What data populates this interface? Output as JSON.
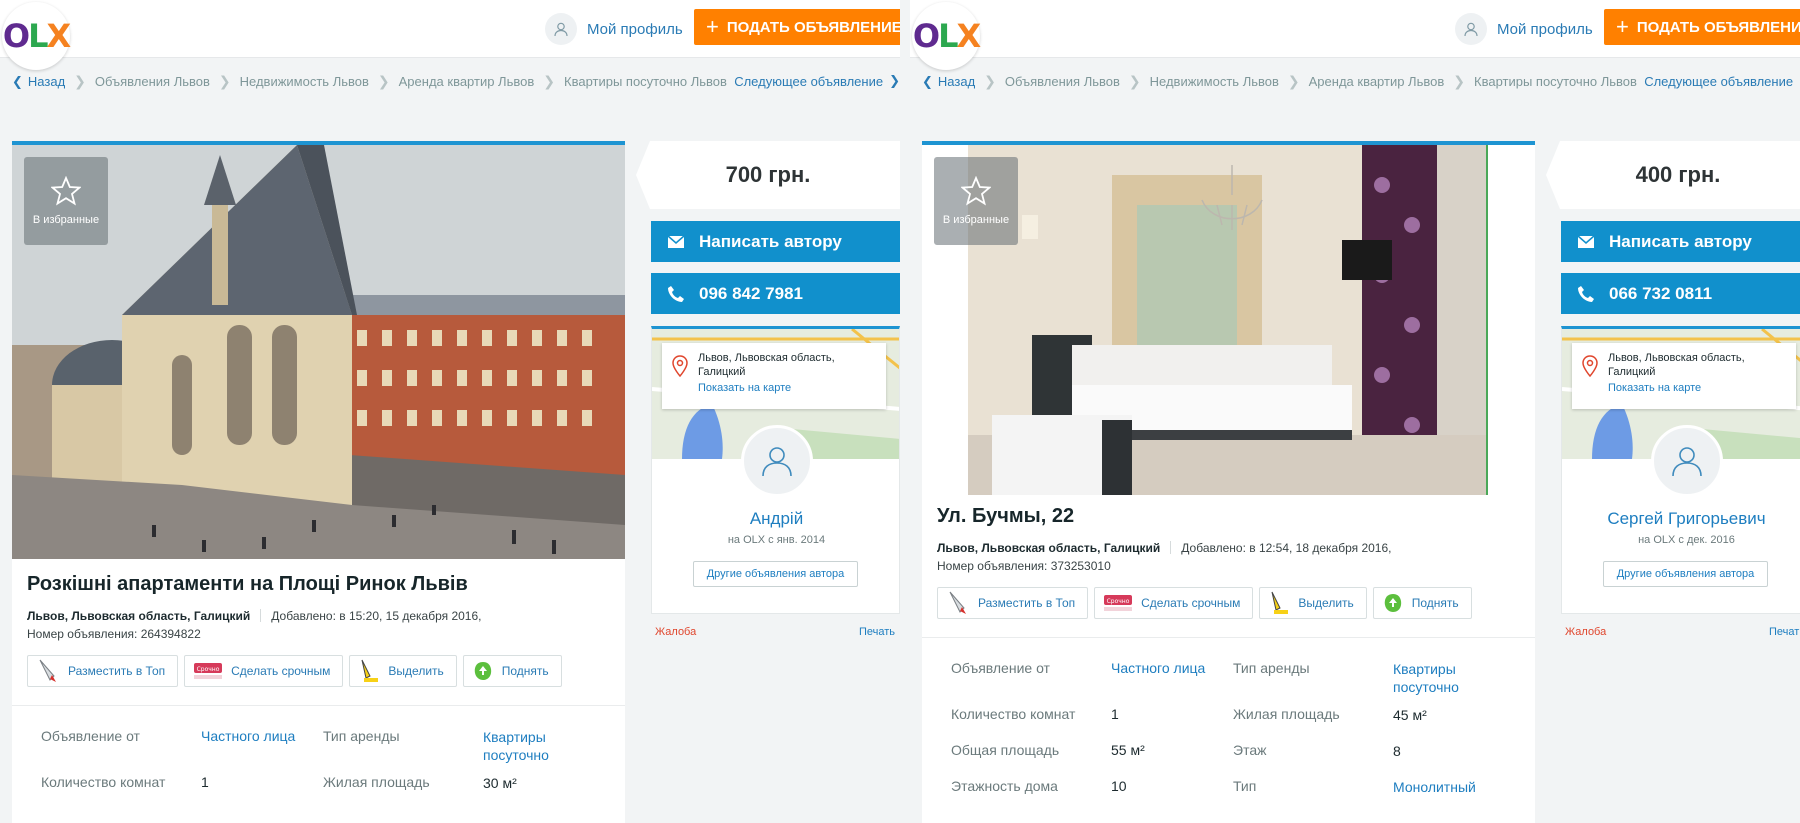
{
  "header": {
    "profile_label": "Мой профиль",
    "post_ad_label": "ПОДАТЬ ОБЪЯВЛЕНИЕ",
    "brand_color": "#ff8000",
    "accent_color": "#1190cc"
  },
  "listings": [
    {
      "breadcrumbs": {
        "back": "Назад",
        "items": [
          "Объявления Львов",
          "Недвижимость Львов",
          "Аренда квартир Львов",
          "Квартиры посуточно Львов"
        ],
        "next": "Следующее объявление"
      },
      "favorite_label": "В избранные",
      "photo_icon": "church-photo",
      "title": "Розкішні апартаменти на Площі Ринок Львів",
      "location": "Львов, Львовская область, Галицкий",
      "added": "Добавлено: в 15:20, 15 декабря 2016,",
      "ad_number": "Номер объявления: 264394822",
      "promo": [
        "Разместить в Топ",
        "Сделать срочным",
        "Выделить",
        "Поднять"
      ],
      "params": [
        [
          "Объявление от",
          "Частного лица",
          "Тип аренды",
          "Квартиры посуточно"
        ],
        [
          "Количество комнат",
          "1",
          "Жилая площадь",
          "30 м²"
        ]
      ],
      "price": "700 грн.",
      "write_author": "Написать автору",
      "phone": "096 842 7981",
      "map_location": "Львов, Львовская область, Галицкий",
      "show_on_map": "Показать на карте",
      "seller_name": "Андрій",
      "seller_since": "на OLX с янв. 2014",
      "other_ads": "Другие объявления автора",
      "complaint": "Жалоба",
      "print": "Печать"
    },
    {
      "breadcrumbs": {
        "back": "Назад",
        "items": [
          "Объявления Львов",
          "Недвижимость Львов",
          "Аренда квартир Львов",
          "Квартиры посуточно Львов"
        ],
        "next": "Следующее объявление"
      },
      "favorite_label": "В избранные",
      "photo_icon": "bedroom-photo",
      "title": "Ул. Бучмы, 22",
      "location": "Львов, Львовская область, Галицкий",
      "added": "Добавлено: в 12:54, 18 декабря 2016,",
      "ad_number": "Номер объявления: 373253010",
      "promo": [
        "Разместить в Топ",
        "Сделать срочным",
        "Выделить",
        "Поднять"
      ],
      "params": [
        [
          "Объявление от",
          "Частного лица",
          "Тип аренды",
          "Квартиры посуточно"
        ],
        [
          "Количество комнат",
          "1",
          "Жилая площадь",
          "45 м²"
        ],
        [
          "Общая площадь",
          "55 м²",
          "Этаж",
          "8"
        ],
        [
          "Этажность дома",
          "10",
          "Тип",
          "Монолитный"
        ]
      ],
      "price": "400 грн.",
      "write_author": "Написать автору",
      "phone": "066 732 0811",
      "map_location": "Львов, Львовская область, Галицкий",
      "show_on_map": "Показать на карте",
      "seller_name": "Сергей Григорьевич",
      "seller_since": "на OLX с дек. 2016",
      "other_ads": "Другие объявления автора",
      "complaint": "Жалоба",
      "print": "Печать"
    }
  ]
}
